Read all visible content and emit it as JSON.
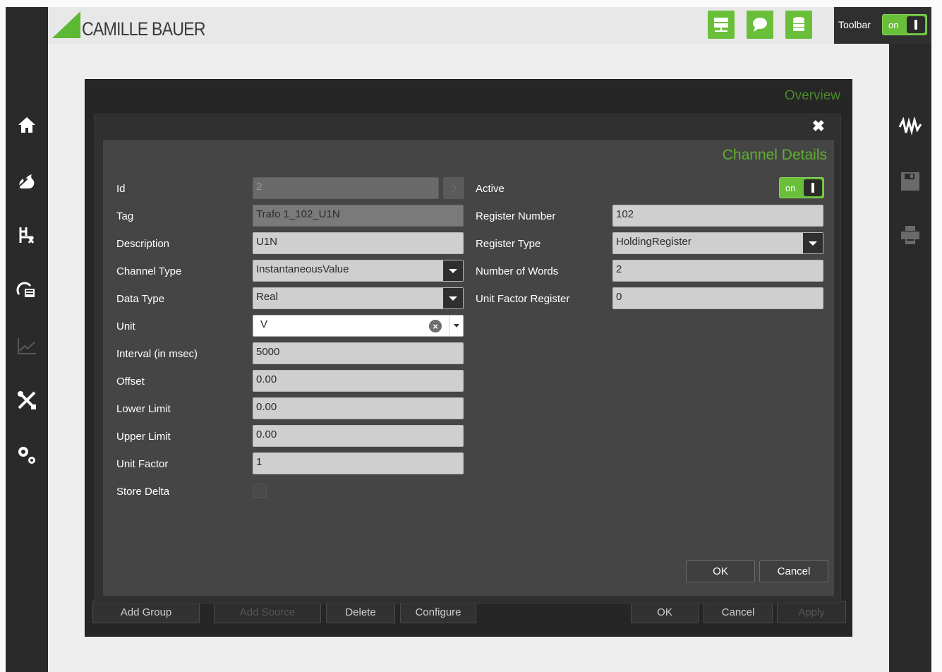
{
  "brand": {
    "name": "CAMILLE BAUER",
    "accent_color": "#6abf3a"
  },
  "header": {
    "buttons": [
      "network-icon",
      "chat-icon",
      "database-icon"
    ],
    "toolbar": {
      "label": "Toolbar",
      "toggle_text": "on"
    }
  },
  "left_nav": [
    "home-icon",
    "fire-icon",
    "switchgear-icon",
    "meter-icon",
    "chart-icon",
    "tools-icon",
    "settings-icon"
  ],
  "right_nav": [
    "waveform-icon",
    "save-icon",
    "print-icon"
  ],
  "panel": {
    "title": "Overview",
    "bottom_buttons": {
      "add_group": "Add Group",
      "add_source": "Add Source",
      "delete": "Delete",
      "configure": "Configure",
      "ok": "OK",
      "cancel": "Cancel",
      "apply": "Apply"
    }
  },
  "dialog": {
    "title": "Channel Details",
    "close": "✖",
    "fields": {
      "id": {
        "label": "Id",
        "value": "2",
        "help": "?"
      },
      "tag": {
        "label": "Tag",
        "value": "Trafo 1_102_U1N"
      },
      "description": {
        "label": "Description",
        "value": "U1N"
      },
      "channel_type": {
        "label": "Channel Type",
        "value": "InstantaneousValue"
      },
      "data_type": {
        "label": "Data Type",
        "value": "Real"
      },
      "unit": {
        "label": "Unit",
        "value": "V"
      },
      "interval": {
        "label": "Interval (in msec)",
        "value": "5000"
      },
      "offset": {
        "label": "Offset",
        "value": "0.00"
      },
      "lower_limit": {
        "label": "Lower Limit",
        "value": "0.00"
      },
      "upper_limit": {
        "label": "Upper Limit",
        "value": "0.00"
      },
      "unit_factor": {
        "label": "Unit Factor",
        "value": "1"
      },
      "store_delta": {
        "label": "Store Delta"
      },
      "active": {
        "label": "Active",
        "toggle_text": "on"
      },
      "register_number": {
        "label": "Register Number",
        "value": "102"
      },
      "register_type": {
        "label": "Register Type",
        "value": "HoldingRegister"
      },
      "number_of_words": {
        "label": "Number of Words",
        "value": "2"
      },
      "unit_factor_register": {
        "label": "Unit Factor Register",
        "value": "0"
      }
    },
    "ok": "OK",
    "cancel": "Cancel"
  }
}
